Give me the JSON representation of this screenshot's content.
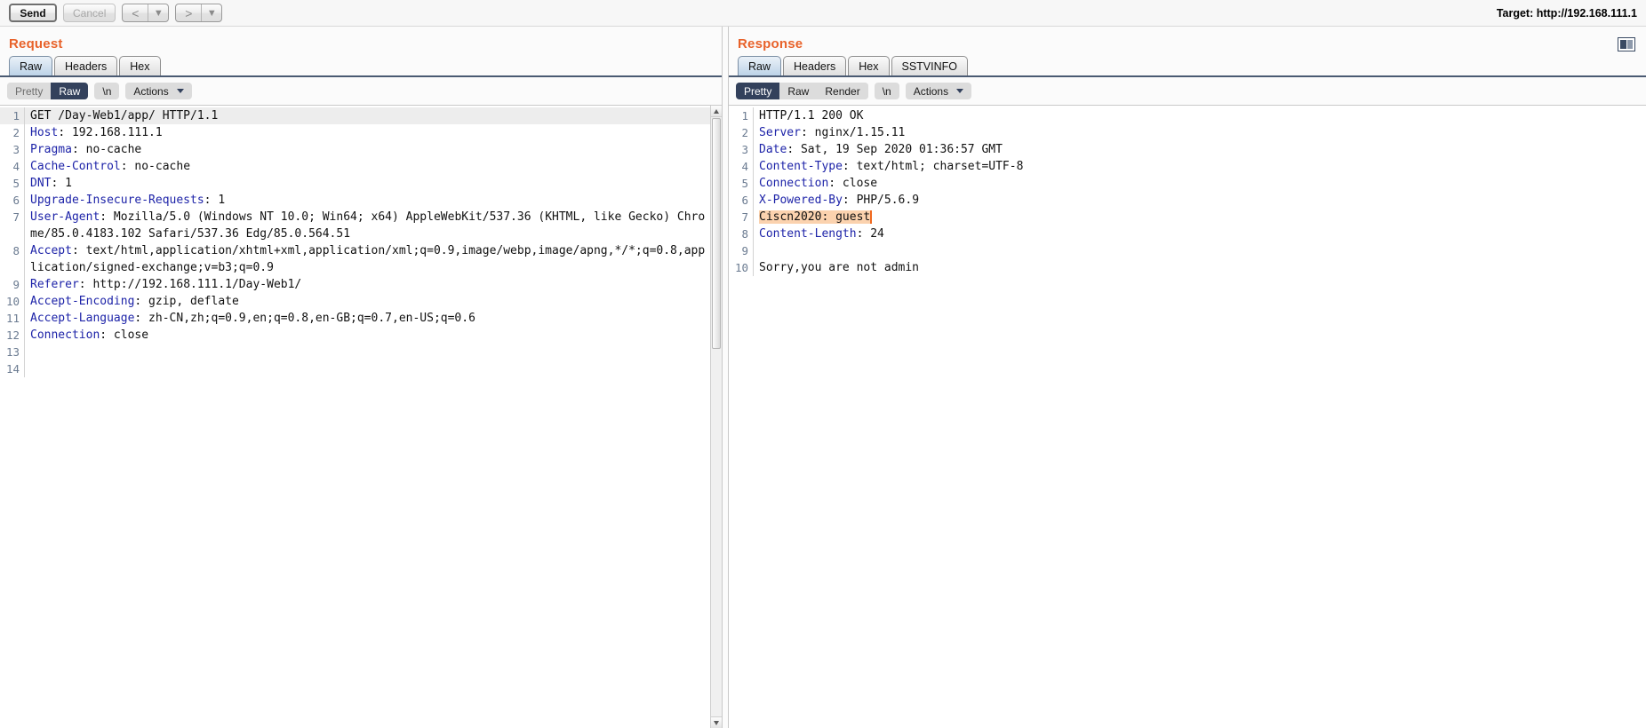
{
  "toolbar": {
    "send_label": "Send",
    "cancel_label": "Cancel",
    "prev_label": "<",
    "next_label": ">",
    "dropdown_glyph": "▼",
    "target_label": "Target: http://192.168.111.1"
  },
  "colors": {
    "accent_orange": "#e8622a",
    "selected_pill": "#33415c",
    "header_key_blue": "#1d23a8",
    "highlight_peach": "#fbd2ae",
    "caret_orange": "#f0691f"
  },
  "request": {
    "title": "Request",
    "tabs": [
      {
        "label": "Raw",
        "active": true
      },
      {
        "label": "Headers",
        "active": false
      },
      {
        "label": "Hex",
        "active": false
      }
    ],
    "view_modes": [
      {
        "label": "Pretty",
        "active": false
      },
      {
        "label": "Raw",
        "active": true
      }
    ],
    "newline_label": "\\n",
    "actions_label": "Actions",
    "lines": [
      {
        "num": "1",
        "current": true,
        "key": "",
        "text": "GET /Day-Web1/app/ HTTP/1.1"
      },
      {
        "num": "2",
        "current": false,
        "key": "Host",
        "text": ": 192.168.111.1"
      },
      {
        "num": "3",
        "current": false,
        "key": "Pragma",
        "text": ": no-cache"
      },
      {
        "num": "4",
        "current": false,
        "key": "Cache-Control",
        "text": ": no-cache"
      },
      {
        "num": "5",
        "current": false,
        "key": "DNT",
        "text": ": 1"
      },
      {
        "num": "6",
        "current": false,
        "key": "Upgrade-Insecure-Requests",
        "text": ": 1"
      },
      {
        "num": "7",
        "current": false,
        "key": "User-Agent",
        "text": ": Mozilla/5.0 (Windows NT 10.0; Win64; x64) AppleWebKit/537.36 (KHTML, like Gecko) Chrome/85.0.4183.102 Safari/537.36 Edg/85.0.564.51"
      },
      {
        "num": "8",
        "current": false,
        "key": "Accept",
        "text": ": text/html,application/xhtml+xml,application/xml;q=0.9,image/webp,image/apng,*/*;q=0.8,application/signed-exchange;v=b3;q=0.9"
      },
      {
        "num": "9",
        "current": false,
        "key": "Referer",
        "text": ": http://192.168.111.1/Day-Web1/"
      },
      {
        "num": "10",
        "current": false,
        "key": "Accept-Encoding",
        "text": ": gzip, deflate"
      },
      {
        "num": "11",
        "current": false,
        "key": "Accept-Language",
        "text": ": zh-CN,zh;q=0.9,en;q=0.8,en-GB;q=0.7,en-US;q=0.6"
      },
      {
        "num": "12",
        "current": false,
        "key": "Connection",
        "text": ": close"
      },
      {
        "num": "13",
        "current": false,
        "key": "",
        "text": ""
      },
      {
        "num": "14",
        "current": false,
        "key": "",
        "text": ""
      }
    ]
  },
  "response": {
    "title": "Response",
    "layout_toggle_name": "split-layout-toggle",
    "tabs": [
      {
        "label": "Raw",
        "active": true
      },
      {
        "label": "Headers",
        "active": false
      },
      {
        "label": "Hex",
        "active": false
      },
      {
        "label": "SSTVINFO",
        "active": false
      }
    ],
    "view_modes": [
      {
        "label": "Pretty",
        "active": true
      },
      {
        "label": "Raw",
        "active": false
      },
      {
        "label": "Render",
        "active": false
      }
    ],
    "newline_label": "\\n",
    "actions_label": "Actions",
    "lines": [
      {
        "num": "1",
        "current": false,
        "key": "",
        "text": "HTTP/1.1 200 OK"
      },
      {
        "num": "2",
        "current": false,
        "key": "Server",
        "text": ": nginx/1.15.11"
      },
      {
        "num": "3",
        "current": false,
        "key": "Date",
        "text": ": Sat, 19 Sep 2020 01:36:57 GMT"
      },
      {
        "num": "4",
        "current": false,
        "key": "Content-Type",
        "text": ": text/html; charset=UTF-8"
      },
      {
        "num": "5",
        "current": false,
        "key": "Connection",
        "text": ": close"
      },
      {
        "num": "6",
        "current": false,
        "key": "X-Powered-By",
        "text": ": PHP/5.6.9"
      },
      {
        "num": "7",
        "current": false,
        "key": "",
        "text": "",
        "highlight": "Ciscn2020: guest"
      },
      {
        "num": "8",
        "current": false,
        "key": "Content-Length",
        "text": ": 24"
      },
      {
        "num": "9",
        "current": false,
        "key": "",
        "text": ""
      },
      {
        "num": "10",
        "current": false,
        "key": "",
        "text": "Sorry,you are not admin"
      }
    ]
  }
}
